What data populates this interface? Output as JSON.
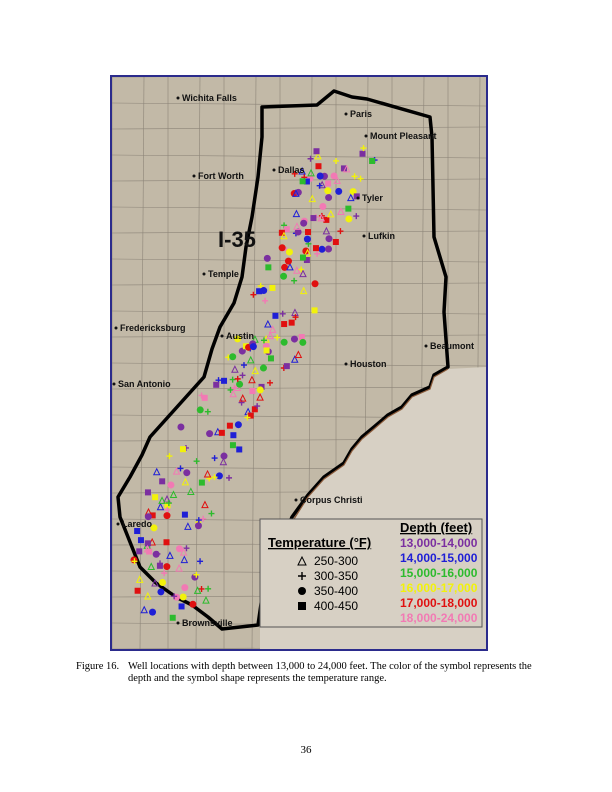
{
  "map": {
    "highway_label": "I-35",
    "cities": [
      {
        "name": "Wichita Falls",
        "id": "wichita-falls"
      },
      {
        "name": "Paris",
        "id": "paris"
      },
      {
        "name": "Mount Pleasant",
        "id": "mount-pleasant"
      },
      {
        "name": "Fort Worth",
        "id": "fort-worth"
      },
      {
        "name": "Dallas",
        "id": "dallas"
      },
      {
        "name": "Tyler",
        "id": "tyler"
      },
      {
        "name": "Temple",
        "id": "temple"
      },
      {
        "name": "Lufkin",
        "id": "lufkin"
      },
      {
        "name": "Fredericksburg",
        "id": "fredericksburg"
      },
      {
        "name": "Austin",
        "id": "austin"
      },
      {
        "name": "Beaumont",
        "id": "beaumont"
      },
      {
        "name": "Houston",
        "id": "houston"
      },
      {
        "name": "San Antonio",
        "id": "san-antonio"
      },
      {
        "name": "Corpus Christi",
        "id": "corpus-christi"
      },
      {
        "name": "Laredo",
        "id": "laredo"
      },
      {
        "name": "Brownsville",
        "id": "brownsville"
      }
    ],
    "legend": {
      "temperature_title": "Temperature (°F)",
      "temperature": [
        {
          "symbol": "triangle",
          "label": "250-300"
        },
        {
          "symbol": "plus",
          "label": "300-350"
        },
        {
          "symbol": "circle",
          "label": "350-400"
        },
        {
          "symbol": "square",
          "label": "400-450"
        }
      ],
      "depth_title": "Depth (feet)",
      "depth": [
        {
          "label": "13,000-14,000",
          "color": "#7b2fa0"
        },
        {
          "label": "14,000-15,000",
          "color": "#1f1fd6"
        },
        {
          "label": "15,000-16,000",
          "color": "#2dbb2d"
        },
        {
          "label": "16,000-17,000",
          "color": "#f2f20a"
        },
        {
          "label": "17,000-18,000",
          "color": "#e01010"
        },
        {
          "label": "18,000-24,000",
          "color": "#f27ab4"
        }
      ]
    }
  },
  "caption": {
    "number": "Figure 16.",
    "text": "Well locations with depth between 13,000 to 24,000 feet.  The color of the symbol represents the depth and the symbol shape represents the temperature range."
  },
  "page_number": "36"
}
